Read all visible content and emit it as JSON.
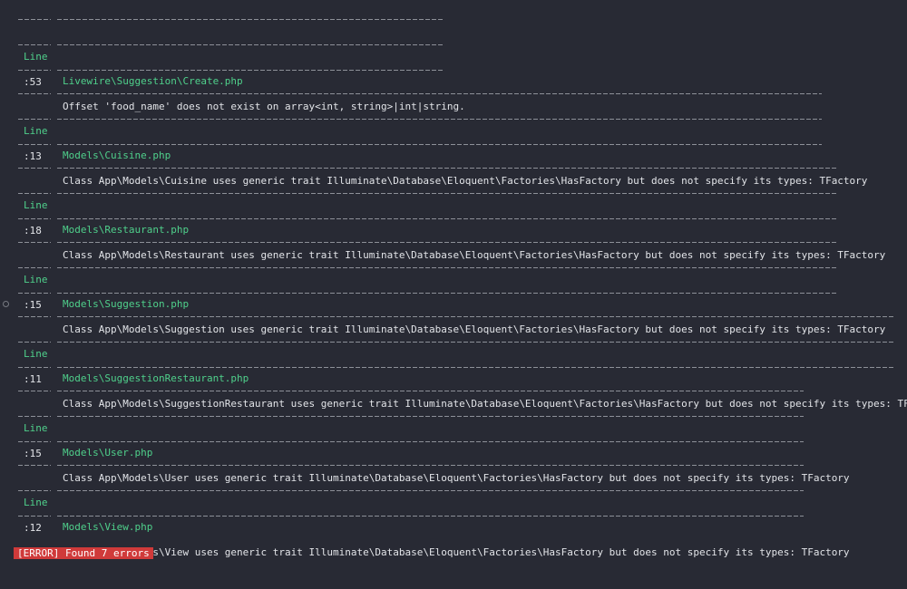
{
  "blocks": [
    {
      "header_line": "Line",
      "file": "Livewire\\Suggestion\\Create.php",
      "line_no": ":53",
      "message": "Offset 'food_name' does not exist on array<int, string>|int|string."
    },
    {
      "header_line": "Line",
      "file": "Models\\Cuisine.php",
      "line_no": ":13",
      "message": "Class App\\Models\\Cuisine uses generic trait Illuminate\\Database\\Eloquent\\Factories\\HasFactory but does not specify its types: TFactory"
    },
    {
      "header_line": "Line",
      "file": "Models\\Restaurant.php",
      "line_no": ":18",
      "message": "Class App\\Models\\Restaurant uses generic trait Illuminate\\Database\\Eloquent\\Factories\\HasFactory but does not specify its types: TFactory"
    },
    {
      "header_line": "Line",
      "file": "Models\\Suggestion.php",
      "line_no": ":15",
      "message": "Class App\\Models\\Suggestion uses generic trait Illuminate\\Database\\Eloquent\\Factories\\HasFactory but does not specify its types: TFactory"
    },
    {
      "header_line": "Line",
      "file": "Models\\SuggestionRestaurant.php",
      "line_no": ":11",
      "message": "Class App\\Models\\SuggestionRestaurant uses generic trait Illuminate\\Database\\Eloquent\\Factories\\HasFactory but does not specify its types: TFactory"
    },
    {
      "header_line": "Line",
      "file": "Models\\User.php",
      "line_no": ":15",
      "message": "Class App\\Models\\User uses generic trait Illuminate\\Database\\Eloquent\\Factories\\HasFactory but does not specify its types: TFactory"
    },
    {
      "header_line": "Line",
      "file": "Models\\View.php",
      "line_no": ":12",
      "message": "Class App\\Models\\View uses generic trait Illuminate\\Database\\Eloquent\\Factories\\HasFactory but does not specify its types: TFactory"
    }
  ],
  "status": {
    "text": "[ERROR] Found 7 errors"
  },
  "colors": {
    "background": "#282a34",
    "header_green": "#4fd08b",
    "error_red": "#d03a3a",
    "text": "#e2e4e8"
  }
}
